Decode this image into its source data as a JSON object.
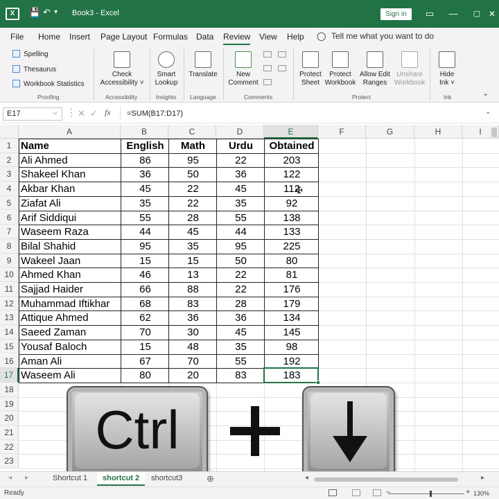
{
  "window": {
    "title": "Book3  -  Excel",
    "sign_in": "Sign in",
    "app_icon_letter": "X",
    "qa_save": "💾",
    "qa_undo": "↶",
    "qa_redo": "↷",
    "qa_customize": "▾",
    "ctrl_options": "▭",
    "ctrl_minimize": "—",
    "ctrl_maximize": "▢",
    "ctrl_close": "✕"
  },
  "menu": {
    "tabs": [
      "File",
      "Home",
      "Insert",
      "Page Layout",
      "Formulas",
      "Data",
      "Review",
      "View",
      "Help"
    ],
    "active": "Review",
    "tell_me": "Tell me what you want to do"
  },
  "ribbon": {
    "proofing": {
      "spelling": "Spelling",
      "thesaurus": "Thesaurus",
      "workbook_statistics": "Workbook Statistics",
      "label": "Proofing"
    },
    "accessibility": {
      "check_line1": "Check",
      "check_line2": "Accessibility ˅",
      "label": "Accessibility"
    },
    "insights": {
      "smart_line1": "Smart",
      "smart_line2": "Lookup",
      "label": "Insights"
    },
    "language": {
      "translate": "Translate",
      "label": "Language"
    },
    "comments": {
      "new_line1": "New",
      "new_line2": "Comment",
      "label": "Comments"
    },
    "protect": {
      "protect_sheet_1": "Protect",
      "protect_sheet_2": "Sheet",
      "protect_workbook_1": "Protect",
      "protect_workbook_2": "Workbook",
      "allow_edit_1": "Allow Edit",
      "allow_edit_2": "Ranges",
      "unshare_1": "Unshare",
      "unshare_2": "Workbook",
      "label": "Protect"
    },
    "ink": {
      "hide_1": "Hide",
      "hide_2": "Ink ˅",
      "label": "Ink"
    }
  },
  "formula_bar": {
    "name_box": "E17",
    "formula": "=SUM(B17:D17)"
  },
  "sheet": {
    "columns": [
      "A",
      "B",
      "C",
      "D",
      "E",
      "F",
      "G",
      "H",
      "I"
    ],
    "row_numbers": [
      "1",
      "2",
      "3",
      "4",
      "5",
      "6",
      "7",
      "8",
      "9",
      "10",
      "11",
      "12",
      "13",
      "14",
      "15",
      "16",
      "17",
      "18",
      "19",
      "20",
      "21",
      "22",
      "23"
    ],
    "headers": [
      "Name",
      "English",
      "Math",
      "Urdu",
      "Obtained"
    ],
    "rows": [
      [
        "Ali Ahmed",
        "86",
        "95",
        "22",
        "203"
      ],
      [
        "Shakeel Khan",
        "36",
        "50",
        "36",
        "122"
      ],
      [
        "Akbar Khan",
        "45",
        "22",
        "45",
        "112"
      ],
      [
        "Ziafat Ali",
        "35",
        "22",
        "35",
        "92"
      ],
      [
        "Arif Siddiqui",
        "55",
        "28",
        "55",
        "138"
      ],
      [
        "Waseem Raza",
        "44",
        "45",
        "44",
        "133"
      ],
      [
        "Bilal Shahid",
        "95",
        "35",
        "95",
        "225"
      ],
      [
        "Wakeel Jaan",
        "15",
        "15",
        "50",
        "80"
      ],
      [
        "Ahmed Khan",
        "46",
        "13",
        "22",
        "81"
      ],
      [
        "Sajjad Haider",
        "66",
        "88",
        "22",
        "176"
      ],
      [
        "Muhammad Iftikhar",
        "68",
        "83",
        "28",
        "179"
      ],
      [
        "Attique Ahmed",
        "62",
        "36",
        "36",
        "134"
      ],
      [
        "Saeed Zaman",
        "70",
        "30",
        "45",
        "145"
      ],
      [
        "Yousaf Baloch",
        "15",
        "48",
        "35",
        "98"
      ],
      [
        "Aman Ali",
        "67",
        "70",
        "55",
        "192"
      ],
      [
        "Waseem Ali",
        "80",
        "20",
        "83",
        "183"
      ]
    ],
    "selected_cell": "E17"
  },
  "overlay": {
    "ctrl_label": "Ctrl",
    "plus": "+",
    "arrow": "down"
  },
  "tabs": {
    "sheets": [
      "Shortcut 1",
      "shortcut 2",
      "shortcut3"
    ],
    "active": "shortcut 2",
    "add": "⊕",
    "nav_prev": "◂",
    "nav_next": "▸",
    "scroll_left": "◂",
    "scroll_right": "▸"
  },
  "status": {
    "ready": "Ready",
    "zoom": "130%",
    "zoom_minus": "–",
    "zoom_plus": "+"
  }
}
